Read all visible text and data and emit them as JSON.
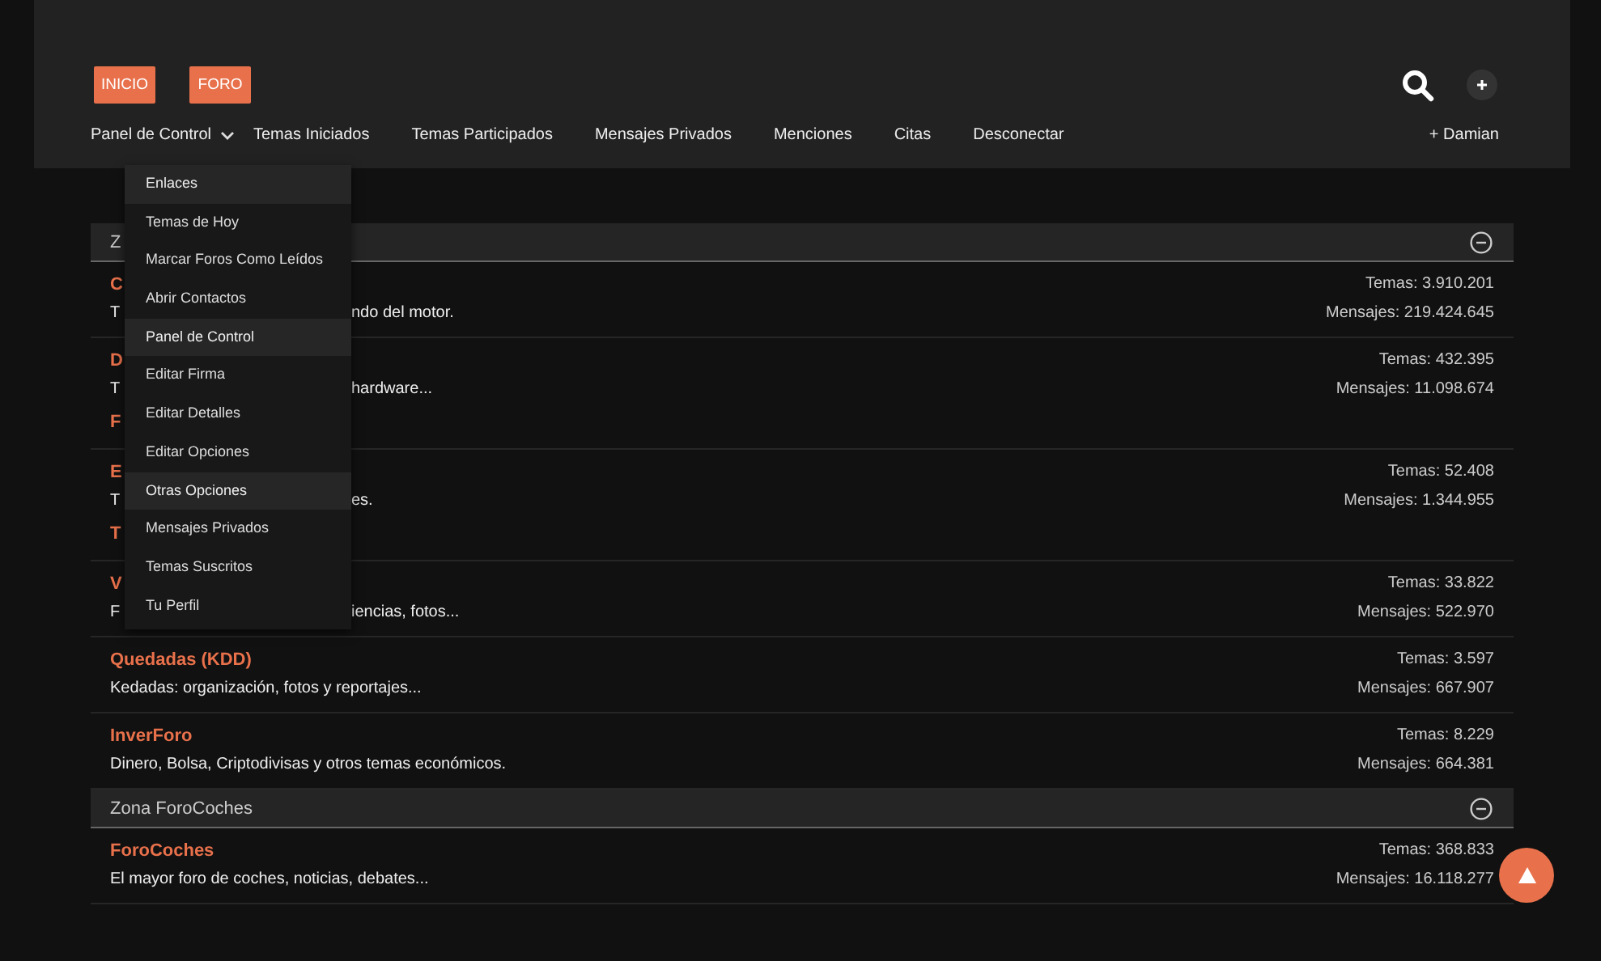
{
  "header": {
    "buttons": [
      "INICIO",
      "FORO"
    ],
    "nav": [
      {
        "label": "Panel de Control",
        "dropdown": true
      },
      {
        "label": "Temas Iniciados",
        "dropdown": false
      },
      {
        "label": "Temas Participados",
        "dropdown": false
      },
      {
        "label": "Mensajes Privados",
        "dropdown": false
      },
      {
        "label": "Menciones",
        "dropdown": false
      },
      {
        "label": "Citas",
        "dropdown": false
      },
      {
        "label": "Desconectar",
        "dropdown": false
      }
    ],
    "user": "+ Damian"
  },
  "dropdown": [
    {
      "label": "Enlaces",
      "highlighted": true
    },
    {
      "label": "Temas de Hoy",
      "highlighted": false
    },
    {
      "label": "Marcar Foros Como Leídos",
      "highlighted": false
    },
    {
      "label": "Abrir Contactos",
      "highlighted": false
    },
    {
      "label": "Panel de Control",
      "highlighted": true
    },
    {
      "label": "Editar Firma",
      "highlighted": false
    },
    {
      "label": "Editar Detalles",
      "highlighted": false
    },
    {
      "label": "Editar Opciones",
      "highlighted": false
    },
    {
      "label": "Otras Opciones",
      "highlighted": true
    },
    {
      "label": "Mensajes Privados",
      "highlighted": false
    },
    {
      "label": "Temas Suscritos",
      "highlighted": false
    },
    {
      "label": "Tu Perfil",
      "highlighted": false
    }
  ],
  "sections": [
    {
      "title": "Z",
      "forums": [
        {
          "kind": "covered",
          "title": "C",
          "description": [
            "T",
            "ndo del motor."
          ],
          "temas": "Temas: 3.910.201",
          "mensajes": "Mensajes: 219.424.645"
        },
        {
          "kind": "covered",
          "title": "D",
          "description": [
            "T",
            "hardware..."
          ],
          "extra": "F",
          "temas": "Temas: 432.395",
          "mensajes": "Mensajes: 11.098.674"
        },
        {
          "kind": "covered",
          "title": "E",
          "description": [
            "T",
            "es."
          ],
          "extra": "T",
          "temas": "Temas: 52.408",
          "mensajes": "Mensajes: 1.344.955"
        },
        {
          "kind": "covered",
          "title": "V",
          "description": [
            "F",
            "iencias, fotos..."
          ],
          "temas": "Temas: 33.822",
          "mensajes": "Mensajes: 522.970"
        },
        {
          "kind": "full",
          "title": "Quedadas (KDD)",
          "description": [
            "Kedadas: organización, fotos y reportajes..."
          ],
          "temas": "Temas: 3.597",
          "mensajes": "Mensajes: 667.907"
        },
        {
          "kind": "full",
          "title": "InverForo",
          "description": [
            "Dinero, Bolsa, Criptodivisas y otros temas económicos."
          ],
          "temas": "Temas: 8.229",
          "mensajes": "Mensajes: 664.381"
        }
      ]
    },
    {
      "title": "Zona ForoCoches",
      "forums": [
        {
          "kind": "full",
          "title": "ForoCoches",
          "description": [
            "El mayor foro de coches, noticias, debates..."
          ],
          "temas": "Temas: 368.833",
          "mensajes": "Mensajes: 16.118.277"
        }
      ]
    }
  ]
}
